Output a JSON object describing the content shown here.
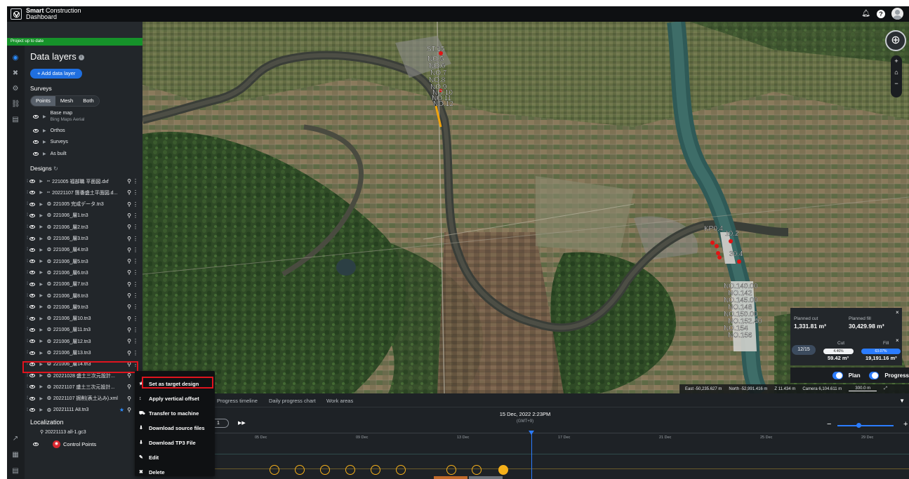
{
  "app": {
    "brand_line1": "Smart Construction",
    "brand_line1_bold": "Smart",
    "brand_line1_rest": " Construction",
    "brand_line2": "Dashboard",
    "help_label": "?"
  },
  "status": {
    "text": "Project up to date",
    "color": "#16922a"
  },
  "panel": {
    "title": "Data layers",
    "add_button": "+ Add data layer",
    "surveys_label": "Surveys",
    "segments": [
      "Points",
      "Mesh",
      "Both"
    ],
    "active_segment": "Points",
    "layers": [
      {
        "label": "Base map",
        "sub": "Bing Maps Aerial"
      },
      {
        "label": "Orthos"
      },
      {
        "label": "Surveys"
      },
      {
        "label": "As built"
      }
    ],
    "designs_label": "Designs",
    "designs": [
      {
        "type": "dxf",
        "name": "221005 福部職 平面図.dxf"
      },
      {
        "type": "dxf",
        "name": "20221107 箇番盛土平面図.d..."
      },
      {
        "type": "tn3",
        "name": "221005 完成データ.tn3"
      },
      {
        "type": "tn3",
        "name": "221006_層1.tn3"
      },
      {
        "type": "tn3",
        "name": "221006_層2.tn3"
      },
      {
        "type": "tn3",
        "name": "221006_層3.tn3"
      },
      {
        "type": "tn3",
        "name": "221006_層4.tn3"
      },
      {
        "type": "tn3",
        "name": "221006_層5.tn3"
      },
      {
        "type": "tn3",
        "name": "221006_層6.tn3"
      },
      {
        "type": "tn3",
        "name": "221006_層7.tn3"
      },
      {
        "type": "tn3",
        "name": "221006_層8.tn3"
      },
      {
        "type": "tn3",
        "name": "221006_層9.tn3"
      },
      {
        "type": "tn3",
        "name": "221006_層10.tn3"
      },
      {
        "type": "tn3",
        "name": "221006_層11.tn3"
      },
      {
        "type": "tn3",
        "name": "221006_層12.tn3"
      },
      {
        "type": "tn3",
        "name": "221006_層13.tn3"
      },
      {
        "type": "tn3",
        "name": "221006_層14.tn3"
      },
      {
        "type": "tn3",
        "name": "20221028 盛土三次元設計..."
      },
      {
        "type": "tn3",
        "name": "20221107 盛土三次元設計..."
      },
      {
        "type": "xml",
        "name": "20221107 掘削(表土込み).xml"
      },
      {
        "type": "tn3",
        "name": "20221111 All.tn3",
        "target": true
      }
    ],
    "localization_label": "Localization",
    "localization_file": "20221113 all-1.gc3",
    "control_points_label": "Control Points"
  },
  "map": {
    "coords": {
      "east": "East -50,235.627 m",
      "north": "North -52,991.416 m",
      "z": "Z 11.434 m",
      "camera": "Camera 6,104.611 m",
      "scale": "300.0 m"
    },
    "markers": [
      "ST.15",
      "NO.5",
      "NO.6",
      "NO.7",
      "NO.8",
      "NO.9",
      "NO.10",
      "NO.11",
      "NO.12",
      "KP0.4",
      "10.2",
      "30.4"
    ],
    "markers2": [
      "NO.140.00",
      "NO.142",
      "NO.145.00",
      "NO.148",
      "NO.150.00",
      "NO.152.40",
      "NO.154",
      "NO.156"
    ]
  },
  "cutfill": {
    "planned_cut_label": "Planned cut",
    "planned_cut_value": "1,331.81 m³",
    "planned_fill_label": "Planned fill",
    "planned_fill_value": "30,429.98 m³",
    "pager": "12/15",
    "cut_label": "Cut",
    "fill_label": "Fill",
    "cut_pct": "4.46%",
    "fill_pct": "63.07%",
    "cut_value": "59.42 m³",
    "fill_value": "19,191.16 m³",
    "close": "×"
  },
  "toggles": {
    "plan": "Plan",
    "progress": "Progress"
  },
  "timeline": {
    "tabs": [
      "Progress timeline",
      "Daily progress chart",
      "Work areas"
    ],
    "date": "15 Dec, 2022 2:23PM",
    "gmt": "(GMT+9)",
    "speed": "1",
    "ticks": [
      "05 Dec",
      "09 Dec",
      "13 Dec",
      "17 Dec",
      "21 Dec",
      "25 Dec",
      "29 Dec"
    ],
    "zoom_minus": "−",
    "zoom_plus": "+",
    "milestone_count": 10,
    "colors": {
      "milestone": "#f5b01a",
      "now": "#2b7cff"
    }
  },
  "context_menu": {
    "items": [
      {
        "label": "Set as target design",
        "icon": "star-icon"
      },
      {
        "label": "Apply vertical offset",
        "icon": "vertical-arrows-icon"
      },
      {
        "label": "Transfer to machine",
        "icon": "excavator-icon"
      },
      {
        "label": "Download source files",
        "icon": "file-download-icon"
      },
      {
        "label": "Download TP3 File",
        "icon": "file-download-icon"
      },
      {
        "label": "Edit",
        "icon": "pencil-icon"
      },
      {
        "label": "Delete",
        "icon": "trash-icon"
      }
    ]
  }
}
